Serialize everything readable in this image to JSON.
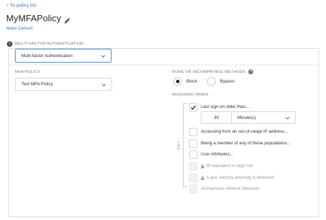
{
  "nav": {
    "back_label": "To policy list"
  },
  "policy": {
    "title": "MyMFAPolicy",
    "make_default": "Make Default"
  },
  "section": {
    "step_number": "1",
    "label": "MULTI-FACTOR AUTHENTICATION"
  },
  "auth_type": {
    "value": "Multi-factor Authentication"
  },
  "mfa_policy": {
    "label": "MFA POLICY",
    "value": "Test MFA Policy"
  },
  "none_methods": {
    "label": "NONE OR INCOMPATIBLE METHODS",
    "options": [
      "Block",
      "Bypass"
    ],
    "selected": "Block"
  },
  "required_when": {
    "label": "REQUIRED WHEN:",
    "group_label": "ANY",
    "conditions": [
      {
        "label": "Last sign-on older than...",
        "checked": true,
        "disabled": false
      },
      {
        "label": "Accessing from an out-of-range IP address...",
        "checked": false,
        "disabled": false
      },
      {
        "label": "Being a member of any of these populations...",
        "checked": false,
        "disabled": false
      },
      {
        "label": "User Attributes...",
        "checked": false,
        "disabled": false
      },
      {
        "label": "IP reputation is high risk",
        "checked": false,
        "disabled": true,
        "locked": true
      },
      {
        "label": "A geo velocity anomaly is detected",
        "checked": false,
        "disabled": true,
        "locked": true
      },
      {
        "label": "Anonymous network detection",
        "checked": false,
        "disabled": true,
        "locked": false
      }
    ],
    "duration": {
      "value": "30",
      "unit": "Minute(s)"
    }
  },
  "colors": {
    "link": "#3d7fc1",
    "focus_border": "#5a9fd4",
    "step_badge": "#3d4a5c"
  }
}
